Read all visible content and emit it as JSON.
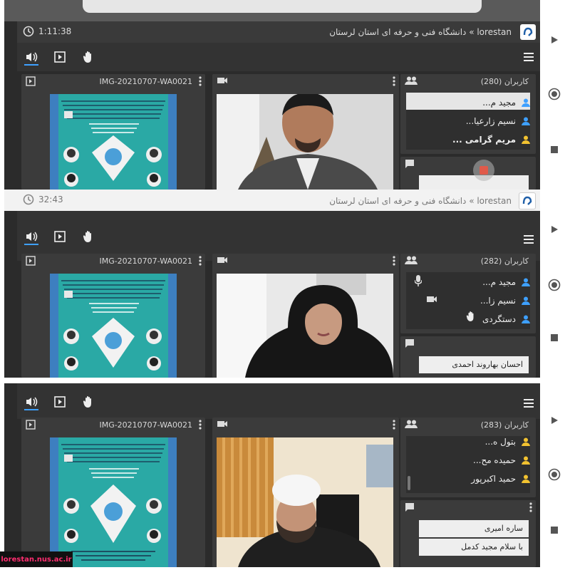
{
  "panels": [
    {
      "clock": "1:11:38",
      "room_title": "lorestan » دانشگاه فنی و حرفه ای استان لرستان",
      "presentation_title": "IMG-20210707-WA0021",
      "users_header": "کاربران (280)",
      "users": [
        {
          "name": "مجید م...",
          "bold": false,
          "mic": false,
          "cam": false,
          "hand": false
        },
        {
          "name": "نسیم زارعیا...",
          "bold": false,
          "mic": false,
          "cam": false,
          "hand": false
        },
        {
          "name": "مریم گرامی ...",
          "bold": true,
          "mic": false,
          "cam": false,
          "hand": false
        }
      ],
      "chat_messages": []
    },
    {
      "clock": "32:43",
      "room_title": "lorestan » دانشگاه فنی و حرفه ای استان لرستان",
      "presentation_title": "IMG-20210707-WA0021",
      "users_header": "کاربران (282)",
      "users": [
        {
          "name": "مجید م...",
          "bold": false,
          "mic": true,
          "cam": false,
          "hand": false
        },
        {
          "name": "نسیم زا...",
          "bold": false,
          "mic": false,
          "cam": true,
          "hand": false
        },
        {
          "name": "دستگردی",
          "bold": false,
          "mic": false,
          "cam": false,
          "hand": true
        }
      ],
      "chat_messages": [
        "احسان بهاروند احمدی"
      ]
    },
    {
      "clock": "",
      "room_title": "",
      "presentation_title": "IMG-20210707-WA0021",
      "users_header": "کاربران (283)",
      "users": [
        {
          "name": "بتول ه...",
          "bold": false,
          "mic": false,
          "cam": false,
          "hand": false
        },
        {
          "name": "حمیده مح...",
          "bold": false,
          "mic": false,
          "cam": false,
          "hand": false
        },
        {
          "name": "حمید اکبرپور",
          "bold": false,
          "mic": false,
          "cam": false,
          "hand": false
        }
      ],
      "chat_messages": [
        "ساره امیری",
        "با سلام مجید کدمل"
      ]
    }
  ],
  "watermark": "lorestan.nus.ac.ir",
  "colors": {
    "user_icon_blue": "#3ea0ff",
    "user_icon_yellow": "#f2c230",
    "poster_teal": "#2aa9a5",
    "watermark_pink": "#ff2d6f"
  }
}
